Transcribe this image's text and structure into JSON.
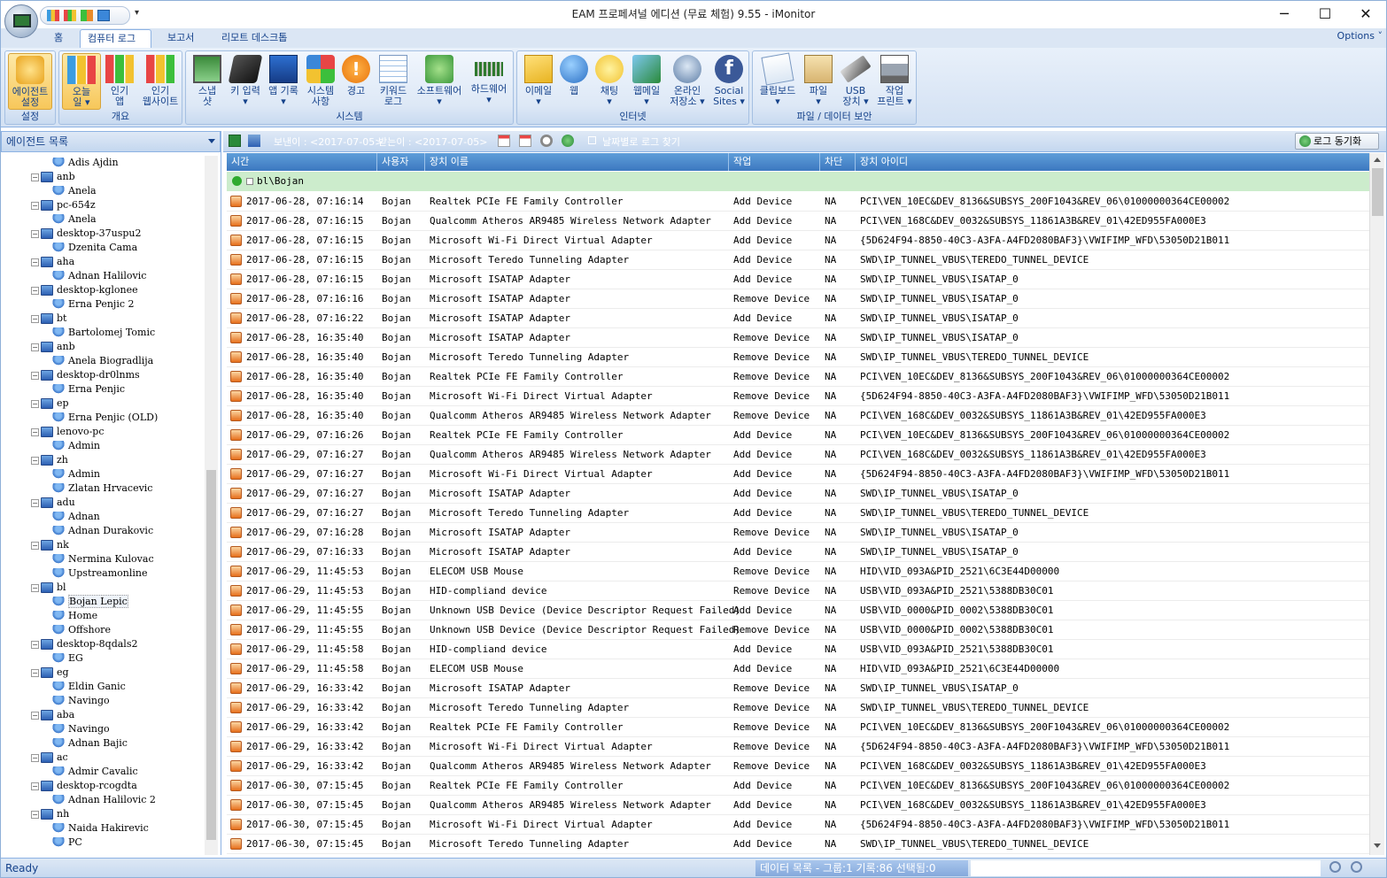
{
  "window": {
    "title": "EAM 프로페셔널 에디션 (무료 체험) 9.55 - iMonitor",
    "minimize": "─",
    "maximize": "☐",
    "close": "✕"
  },
  "tabs": [
    "홈",
    "컴퓨터 로그",
    "보고서",
    "리모트 데스크톱"
  ],
  "options_label": "Options ˅",
  "ribbon": {
    "groups": [
      "설정",
      "개요",
      "시스템",
      "인터넷",
      "파일 / 데이터 보안"
    ],
    "buttons": [
      {
        "l1": "에이전트",
        "l2": "설정"
      },
      {
        "l1": "오늘",
        "l2": "일 ▾"
      },
      {
        "l1": "인기",
        "l2": "앱"
      },
      {
        "l1": "인기",
        "l2": "웹사이트"
      },
      {
        "l1": "스냅",
        "l2": "샷"
      },
      {
        "l1": "키 입력",
        "l2": "▾"
      },
      {
        "l1": "앱 기록",
        "l2": "▾"
      },
      {
        "l1": "시스템",
        "l2": "사항"
      },
      {
        "l1": "경고",
        "l2": ""
      },
      {
        "l1": "키워드",
        "l2": "로그"
      },
      {
        "l1": "소프트웨어",
        "l2": "▾"
      },
      {
        "l1": "하드웨어",
        "l2": "▾"
      },
      {
        "l1": "이메일",
        "l2": "▾"
      },
      {
        "l1": "웹",
        "l2": ""
      },
      {
        "l1": "채팅",
        "l2": "▾"
      },
      {
        "l1": "웹메일",
        "l2": "▾"
      },
      {
        "l1": "온라인",
        "l2": "저장소 ▾"
      },
      {
        "l1": "Social",
        "l2": "Sites ▾"
      },
      {
        "l1": "클립보드",
        "l2": "▾"
      },
      {
        "l1": "파일",
        "l2": "▾"
      },
      {
        "l1": "USB",
        "l2": "장치 ▾"
      },
      {
        "l1": "작업",
        "l2": "프린트 ▾"
      }
    ]
  },
  "left_pane": {
    "title": "에이전트 목록",
    "tree": [
      {
        "t": "Adis Ajdin",
        "k": "u"
      },
      {
        "t": "anb",
        "k": "c"
      },
      {
        "t": "Anela",
        "k": "u"
      },
      {
        "t": "pc-654z",
        "k": "c"
      },
      {
        "t": "Anela",
        "k": "u"
      },
      {
        "t": "desktop-37uspu2",
        "k": "c"
      },
      {
        "t": "Dzenita Cama",
        "k": "u"
      },
      {
        "t": "aha",
        "k": "c"
      },
      {
        "t": "Adnan Halilovic",
        "k": "u"
      },
      {
        "t": "desktop-kglonee",
        "k": "c"
      },
      {
        "t": "Erna Penjic 2",
        "k": "u"
      },
      {
        "t": "bt",
        "k": "c"
      },
      {
        "t": "Bartolomej Tomic",
        "k": "u"
      },
      {
        "t": "anb",
        "k": "c"
      },
      {
        "t": "Anela Biogradlija",
        "k": "u"
      },
      {
        "t": "desktop-dr0lnms",
        "k": "c"
      },
      {
        "t": "Erna Penjic",
        "k": "u"
      },
      {
        "t": "ep",
        "k": "c"
      },
      {
        "t": "Erna Penjic (OLD)",
        "k": "u"
      },
      {
        "t": "lenovo-pc",
        "k": "c"
      },
      {
        "t": "Admin",
        "k": "u"
      },
      {
        "t": "zh",
        "k": "c"
      },
      {
        "t": "Admin",
        "k": "u"
      },
      {
        "t": "Zlatan Hrvacevic",
        "k": "u"
      },
      {
        "t": "adu",
        "k": "c"
      },
      {
        "t": "Adnan",
        "k": "u"
      },
      {
        "t": "Adnan Durakovic",
        "k": "u"
      },
      {
        "t": "nk",
        "k": "c"
      },
      {
        "t": "Nermina Kulovac",
        "k": "u"
      },
      {
        "t": "Upstreamonline",
        "k": "u"
      },
      {
        "t": "bl",
        "k": "c"
      },
      {
        "t": "Bojan Lepic",
        "k": "u"
      },
      {
        "t": "Home",
        "k": "u"
      },
      {
        "t": "Offshore",
        "k": "u"
      },
      {
        "t": "desktop-8qdals2",
        "k": "c"
      },
      {
        "t": "EG",
        "k": "u"
      },
      {
        "t": "eg",
        "k": "c"
      },
      {
        "t": "Eldin Ganic",
        "k": "u"
      },
      {
        "t": "Navingo",
        "k": "u"
      },
      {
        "t": "aba",
        "k": "c"
      },
      {
        "t": "Navingo",
        "k": "u"
      },
      {
        "t": "Adnan Bajic",
        "k": "u"
      },
      {
        "t": "ac",
        "k": "c"
      },
      {
        "t": "Admir Cavalic",
        "k": "u"
      },
      {
        "t": "desktop-rcogdta",
        "k": "c"
      },
      {
        "t": "Adnan Halilovic 2",
        "k": "u"
      },
      {
        "t": "nh",
        "k": "c"
      },
      {
        "t": "Naida Hakirevic",
        "k": "u"
      },
      {
        "t": "PC",
        "k": "u"
      }
    ]
  },
  "toolbar": {
    "from_label": "보낸이 : <2017-07-05>",
    "to_label": "받는이 : <2017-07-05>",
    "find_label": "날짜별로 로그 찾기",
    "sync_label": "로그 동기화"
  },
  "grid": {
    "columns": [
      "시간",
      "사용자",
      "장치 이름",
      "작업",
      "차단",
      "장치 아이디"
    ],
    "group": "bl\\Bojan",
    "rows": [
      [
        "2017-06-28, 07:16:14",
        "Bojan",
        "Realtek PCIe FE Family Controller",
        "Add Device",
        "NA",
        "PCI\\VEN_10EC&DEV_8136&SUBSYS_200F1043&REV_06\\01000000364CE00002"
      ],
      [
        "2017-06-28, 07:16:15",
        "Bojan",
        "Qualcomm Atheros AR9485 Wireless Network Adapter",
        "Add Device",
        "NA",
        "PCI\\VEN_168C&DEV_0032&SUBSYS_11861A3B&REV_01\\42ED955FA000E3"
      ],
      [
        "2017-06-28, 07:16:15",
        "Bojan",
        "Microsoft Wi-Fi Direct Virtual Adapter",
        "Add Device",
        "NA",
        "{5D624F94-8850-40C3-A3FA-A4FD2080BAF3}\\VWIFIMP_WFD\\53050D21B011"
      ],
      [
        "2017-06-28, 07:16:15",
        "Bojan",
        "Microsoft Teredo Tunneling Adapter",
        "Add Device",
        "NA",
        "SWD\\IP_TUNNEL_VBUS\\TEREDO_TUNNEL_DEVICE"
      ],
      [
        "2017-06-28, 07:16:15",
        "Bojan",
        "Microsoft ISATAP Adapter",
        "Add Device",
        "NA",
        "SWD\\IP_TUNNEL_VBUS\\ISATAP_0"
      ],
      [
        "2017-06-28, 07:16:16",
        "Bojan",
        "Microsoft ISATAP Adapter",
        "Remove Device",
        "NA",
        "SWD\\IP_TUNNEL_VBUS\\ISATAP_0"
      ],
      [
        "2017-06-28, 07:16:22",
        "Bojan",
        "Microsoft ISATAP Adapter",
        "Add Device",
        "NA",
        "SWD\\IP_TUNNEL_VBUS\\ISATAP_0"
      ],
      [
        "2017-06-28, 16:35:40",
        "Bojan",
        "Microsoft ISATAP Adapter",
        "Remove Device",
        "NA",
        "SWD\\IP_TUNNEL_VBUS\\ISATAP_0"
      ],
      [
        "2017-06-28, 16:35:40",
        "Bojan",
        "Microsoft Teredo Tunneling Adapter",
        "Remove Device",
        "NA",
        "SWD\\IP_TUNNEL_VBUS\\TEREDO_TUNNEL_DEVICE"
      ],
      [
        "2017-06-28, 16:35:40",
        "Bojan",
        "Realtek PCIe FE Family Controller",
        "Remove Device",
        "NA",
        "PCI\\VEN_10EC&DEV_8136&SUBSYS_200F1043&REV_06\\01000000364CE00002"
      ],
      [
        "2017-06-28, 16:35:40",
        "Bojan",
        "Microsoft Wi-Fi Direct Virtual Adapter",
        "Remove Device",
        "NA",
        "{5D624F94-8850-40C3-A3FA-A4FD2080BAF3}\\VWIFIMP_WFD\\53050D21B011"
      ],
      [
        "2017-06-28, 16:35:40",
        "Bojan",
        "Qualcomm Atheros AR9485 Wireless Network Adapter",
        "Remove Device",
        "NA",
        "PCI\\VEN_168C&DEV_0032&SUBSYS_11861A3B&REV_01\\42ED955FA000E3"
      ],
      [
        "2017-06-29, 07:16:26",
        "Bojan",
        "Realtek PCIe FE Family Controller",
        "Add Device",
        "NA",
        "PCI\\VEN_10EC&DEV_8136&SUBSYS_200F1043&REV_06\\01000000364CE00002"
      ],
      [
        "2017-06-29, 07:16:27",
        "Bojan",
        "Qualcomm Atheros AR9485 Wireless Network Adapter",
        "Add Device",
        "NA",
        "PCI\\VEN_168C&DEV_0032&SUBSYS_11861A3B&REV_01\\42ED955FA000E3"
      ],
      [
        "2017-06-29, 07:16:27",
        "Bojan",
        "Microsoft Wi-Fi Direct Virtual Adapter",
        "Add Device",
        "NA",
        "{5D624F94-8850-40C3-A3FA-A4FD2080BAF3}\\VWIFIMP_WFD\\53050D21B011"
      ],
      [
        "2017-06-29, 07:16:27",
        "Bojan",
        "Microsoft ISATAP Adapter",
        "Add Device",
        "NA",
        "SWD\\IP_TUNNEL_VBUS\\ISATAP_0"
      ],
      [
        "2017-06-29, 07:16:27",
        "Bojan",
        "Microsoft Teredo Tunneling Adapter",
        "Add Device",
        "NA",
        "SWD\\IP_TUNNEL_VBUS\\TEREDO_TUNNEL_DEVICE"
      ],
      [
        "2017-06-29, 07:16:28",
        "Bojan",
        "Microsoft ISATAP Adapter",
        "Remove Device",
        "NA",
        "SWD\\IP_TUNNEL_VBUS\\ISATAP_0"
      ],
      [
        "2017-06-29, 07:16:33",
        "Bojan",
        "Microsoft ISATAP Adapter",
        "Add Device",
        "NA",
        "SWD\\IP_TUNNEL_VBUS\\ISATAP_0"
      ],
      [
        "2017-06-29, 11:45:53",
        "Bojan",
        "ELECOM USB Mouse",
        "Remove Device",
        "NA",
        "HID\\VID_093A&PID_2521\\6C3E44D00000"
      ],
      [
        "2017-06-29, 11:45:53",
        "Bojan",
        "HID-compliand device",
        "Remove Device",
        "NA",
        "USB\\VID_093A&PID_2521\\5388DB30C01"
      ],
      [
        "2017-06-29, 11:45:55",
        "Bojan",
        "Unknown USB Device (Device Descriptor Request Failed)",
        "Add Device",
        "NA",
        "USB\\VID_0000&PID_0002\\5388DB30C01"
      ],
      [
        "2017-06-29, 11:45:55",
        "Bojan",
        "Unknown USB Device (Device Descriptor Request Failed)",
        "Remove Device",
        "NA",
        "USB\\VID_0000&PID_0002\\5388DB30C01"
      ],
      [
        "2017-06-29, 11:45:58",
        "Bojan",
        "HID-compliand device",
        "Add Device",
        "NA",
        "USB\\VID_093A&PID_2521\\5388DB30C01"
      ],
      [
        "2017-06-29, 11:45:58",
        "Bojan",
        "ELECOM USB Mouse",
        "Add Device",
        "NA",
        "HID\\VID_093A&PID_2521\\6C3E44D00000"
      ],
      [
        "2017-06-29, 16:33:42",
        "Bojan",
        "Microsoft ISATAP Adapter",
        "Remove Device",
        "NA",
        "SWD\\IP_TUNNEL_VBUS\\ISATAP_0"
      ],
      [
        "2017-06-29, 16:33:42",
        "Bojan",
        "Microsoft Teredo Tunneling Adapter",
        "Remove Device",
        "NA",
        "SWD\\IP_TUNNEL_VBUS\\TEREDO_TUNNEL_DEVICE"
      ],
      [
        "2017-06-29, 16:33:42",
        "Bojan",
        "Realtek PCIe FE Family Controller",
        "Remove Device",
        "NA",
        "PCI\\VEN_10EC&DEV_8136&SUBSYS_200F1043&REV_06\\01000000364CE00002"
      ],
      [
        "2017-06-29, 16:33:42",
        "Bojan",
        "Microsoft Wi-Fi Direct Virtual Adapter",
        "Remove Device",
        "NA",
        "{5D624F94-8850-40C3-A3FA-A4FD2080BAF3}\\VWIFIMP_WFD\\53050D21B011"
      ],
      [
        "2017-06-29, 16:33:42",
        "Bojan",
        "Qualcomm Atheros AR9485 Wireless Network Adapter",
        "Remove Device",
        "NA",
        "PCI\\VEN_168C&DEV_0032&SUBSYS_11861A3B&REV_01\\42ED955FA000E3"
      ],
      [
        "2017-06-30, 07:15:45",
        "Bojan",
        "Realtek PCIe FE Family Controller",
        "Add Device",
        "NA",
        "PCI\\VEN_10EC&DEV_8136&SUBSYS_200F1043&REV_06\\01000000364CE00002"
      ],
      [
        "2017-06-30, 07:15:45",
        "Bojan",
        "Qualcomm Atheros AR9485 Wireless Network Adapter",
        "Add Device",
        "NA",
        "PCI\\VEN_168C&DEV_0032&SUBSYS_11861A3B&REV_01\\42ED955FA000E3"
      ],
      [
        "2017-06-30, 07:15:45",
        "Bojan",
        "Microsoft Wi-Fi Direct Virtual Adapter",
        "Add Device",
        "NA",
        "{5D624F94-8850-40C3-A3FA-A4FD2080BAF3}\\VWIFIMP_WFD\\53050D21B011"
      ],
      [
        "2017-06-30, 07:15:45",
        "Bojan",
        "Microsoft Teredo Tunneling Adapter",
        "Add Device",
        "NA",
        "SWD\\IP_TUNNEL_VBUS\\TEREDO_TUNNEL_DEVICE"
      ]
    ]
  },
  "status": {
    "ready": "Ready",
    "data": "데이터 목록 - 그룹:1 기록:86 선택됨:0"
  }
}
